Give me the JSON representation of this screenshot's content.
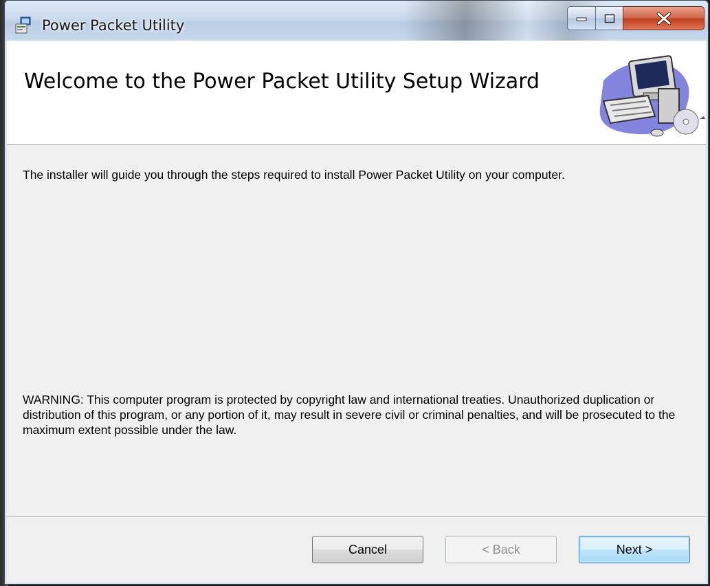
{
  "window": {
    "title": "Power Packet Utility"
  },
  "banner": {
    "title": "Welcome to the Power Packet Utility  Setup Wizard",
    "art_icon": "computer-cd-icon"
  },
  "content": {
    "intro": "The installer will guide you through the steps required to install Power Packet Utility  on your computer.",
    "warning": "WARNING: This computer program is protected by copyright law and international treaties. Unauthorized duplication or distribution of this program, or any portion of it, may result in severe civil or criminal penalties, and will be prosecuted to the maximum extent possible under the law."
  },
  "buttons": {
    "cancel": "Cancel",
    "back": "< Back",
    "next": "Next >"
  },
  "colors": {
    "close_button": "#c2401e",
    "next_button_border": "#3c7fb1",
    "disabled_text": "#8d8d8d"
  }
}
